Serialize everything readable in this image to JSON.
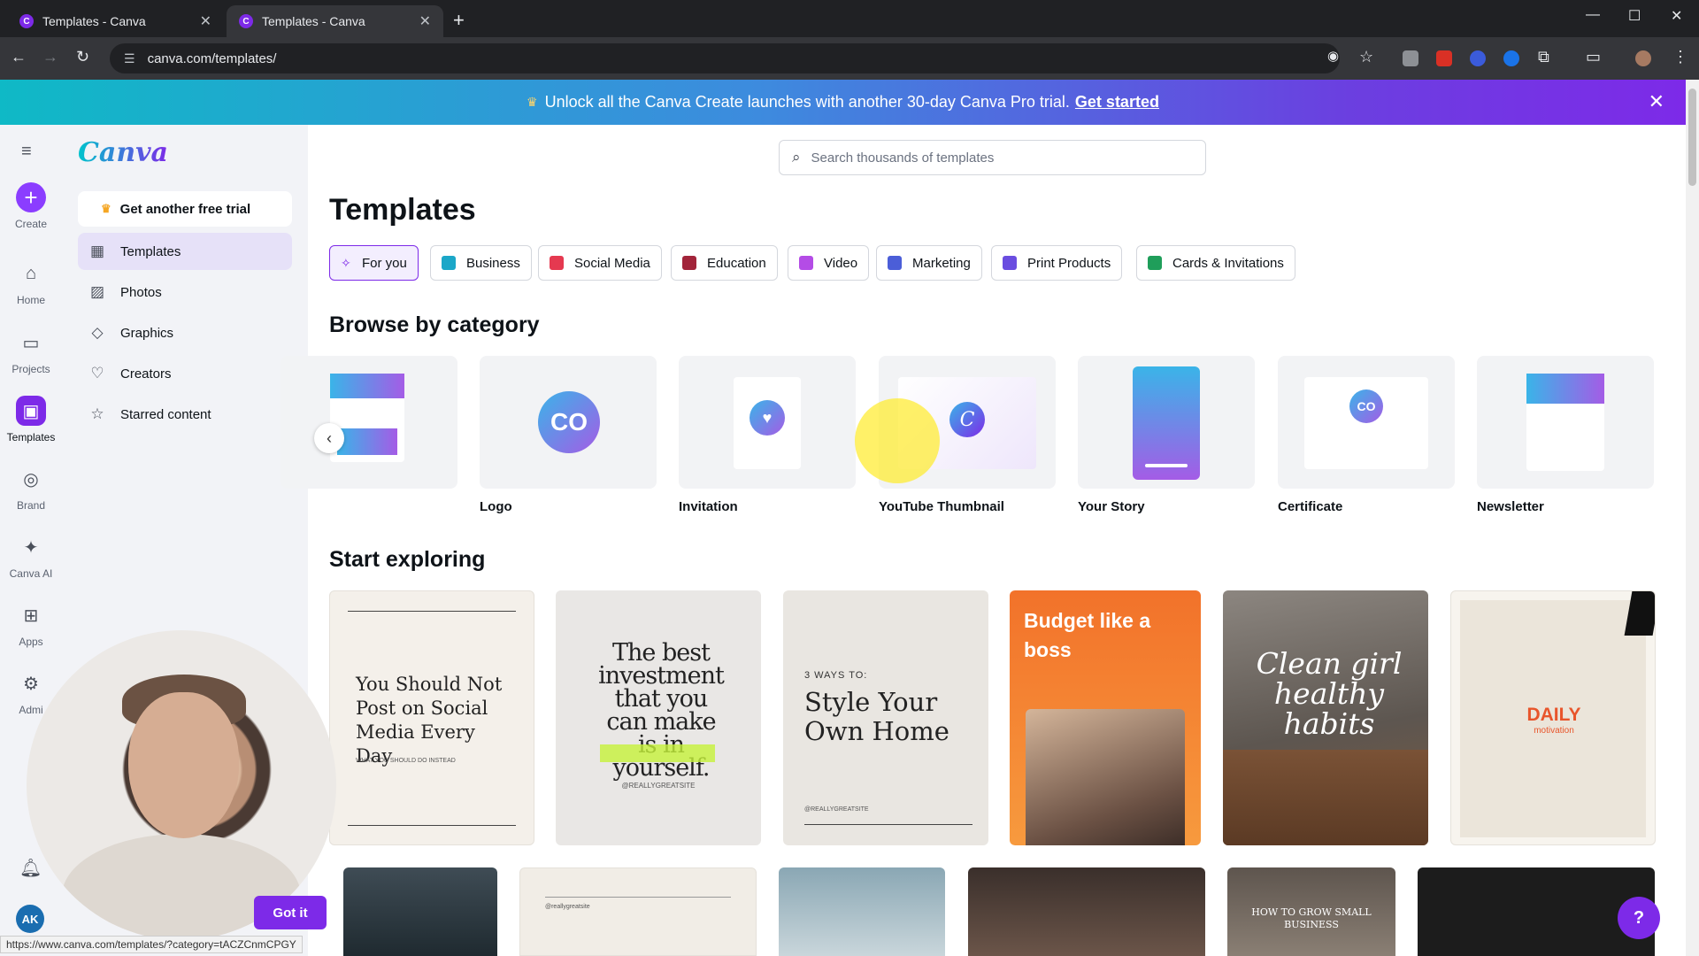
{
  "browser": {
    "tabs": [
      {
        "title": "Templates - Canva",
        "active": false
      },
      {
        "title": "Templates - Canva",
        "active": true
      }
    ],
    "url": "canva.com/templates/",
    "status_url": "https://www.canva.com/templates/?category=tACZCnmCPGY"
  },
  "banner": {
    "text": "Unlock all the Canva Create launches with another 30-day Canva Pro trial.",
    "link": "Get started"
  },
  "rail": {
    "items": [
      {
        "label": "Create",
        "icon": "plus-icon"
      },
      {
        "label": "Home",
        "icon": "home-icon"
      },
      {
        "label": "Projects",
        "icon": "folder-icon"
      },
      {
        "label": "Templates",
        "icon": "templates-icon"
      },
      {
        "label": "Brand",
        "icon": "brand-icon"
      },
      {
        "label": "Canva AI",
        "icon": "sparkle-icon"
      },
      {
        "label": "Apps",
        "icon": "apps-icon"
      },
      {
        "label": "Admi",
        "icon": "gear-icon"
      }
    ],
    "avatar_initials": "AK"
  },
  "sidepanel": {
    "logo": "Canva",
    "trial_button": "Get another free trial",
    "items": [
      {
        "label": "Templates",
        "icon": "templates-icon"
      },
      {
        "label": "Photos",
        "icon": "photo-icon"
      },
      {
        "label": "Graphics",
        "icon": "shapes-icon"
      },
      {
        "label": "Creators",
        "icon": "heart-icon"
      },
      {
        "label": "Starred content",
        "icon": "star-icon"
      }
    ]
  },
  "main": {
    "search_placeholder": "Search thousands of templates",
    "title": "Templates",
    "chips": [
      {
        "label": "For you",
        "color": "#7d2ae8"
      },
      {
        "label": "Business",
        "color": "#1ba7c8"
      },
      {
        "label": "Social Media",
        "color": "#e53950"
      },
      {
        "label": "Education",
        "color": "#a2243a"
      },
      {
        "label": "Video",
        "color": "#b44ce6"
      },
      {
        "label": "Marketing",
        "color": "#4b5ed8"
      },
      {
        "label": "Print Products",
        "color": "#6a4de0"
      },
      {
        "label": "Cards & Invitations",
        "color": "#1f9e5a"
      }
    ],
    "browse_heading": "Browse by category",
    "categories": [
      "",
      "Logo",
      "Invitation",
      "YouTube Thumbnail",
      "Your Story",
      "Certificate",
      "Newsletter"
    ],
    "category_logo_text": [
      "CO",
      "C",
      "CO"
    ],
    "explore_heading": "Start exploring",
    "cards": [
      {
        "text": "You Should Not Post on Social Media Every Day",
        "sub": "WHAT YOU SHOULD DO INSTEAD"
      },
      {
        "text": "The best investment that you can make is in yourself.",
        "sub": "@REALLYGREATSITE"
      },
      {
        "kicker": "3 WAYS TO:",
        "text": "Style Your Own Home",
        "sub": "@REALLYGREATSITE"
      },
      {
        "text": "Budget like a boss"
      },
      {
        "text": "Clean girl healthy habits"
      },
      {
        "text": "DAILY",
        "sub": "motivation"
      }
    ],
    "cards_row2": [
      "",
      "@reallygreatsite",
      "",
      "",
      "HOW TO GROW SMALL BUSINESS",
      ""
    ]
  },
  "overlay": {
    "got_it": "Got it",
    "help": "?"
  }
}
